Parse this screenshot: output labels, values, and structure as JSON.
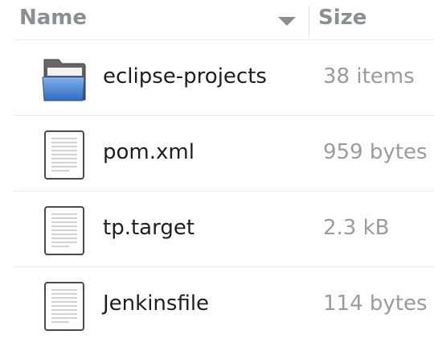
{
  "columns": {
    "name_label": "Name",
    "size_label": "Size"
  },
  "files": [
    {
      "name": "eclipse-projects",
      "size": "38 items",
      "icon": "folder-icon"
    },
    {
      "name": "pom.xml",
      "size": "959 bytes",
      "icon": "document-icon"
    },
    {
      "name": "tp.target",
      "size": "2.3 kB",
      "icon": "document-icon"
    },
    {
      "name": "Jenkinsfile",
      "size": "114 bytes",
      "icon": "document-icon"
    }
  ],
  "colors": {
    "header_text": "#8c8f8f",
    "name_text": "#1e1e1e",
    "size_text": "#9b9b9b",
    "folder_blue": "#3d7fd1"
  }
}
